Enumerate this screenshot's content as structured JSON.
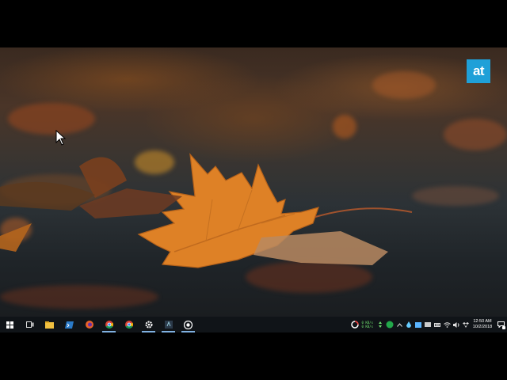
{
  "watermark": {
    "logo_text": "at",
    "logo_color": "#1fa0d8"
  },
  "wallpaper": {
    "subject": "autumn maple leaf on asphalt",
    "accent": "#e08a2a"
  },
  "taskbar": {
    "background": "#101418",
    "pinned": [
      {
        "name": "start-button",
        "icon": "windows-icon"
      },
      {
        "name": "task-view-button",
        "icon": "task-view-icon"
      },
      {
        "name": "file-explorer-button",
        "icon": "folder-icon"
      },
      {
        "name": "powershell-button",
        "icon": "terminal-icon"
      },
      {
        "name": "firefox-button",
        "icon": "firefox-icon"
      },
      {
        "name": "chrome-button",
        "icon": "chrome-icon"
      },
      {
        "name": "chrome-canary-button",
        "icon": "chrome-icon"
      },
      {
        "name": "settings-button",
        "icon": "gear-icon"
      },
      {
        "name": "app-button",
        "icon": "app-icon"
      },
      {
        "name": "obs-button",
        "icon": "record-icon"
      }
    ],
    "net_speed": {
      "up": "0 KB/s",
      "down": "0 KB/s"
    },
    "clock": {
      "time": "12:50 AM",
      "date": "10/2/2018"
    }
  }
}
